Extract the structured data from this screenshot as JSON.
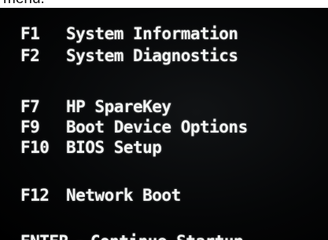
{
  "caption": "menu.",
  "menu": {
    "items": [
      {
        "key": "F1",
        "label": "System Information"
      },
      {
        "key": "F2",
        "label": "System Diagnostics"
      },
      {
        "key": "F7",
        "label": "HP SpareKey"
      },
      {
        "key": "F9",
        "label": "Boot Device Options"
      },
      {
        "key": "F10",
        "label": "BIOS Setup"
      },
      {
        "key": "F12",
        "label": "Network Boot"
      }
    ],
    "enter": {
      "key": "ENTER",
      "separator": "-",
      "label": "Continue Startup"
    }
  },
  "colors": {
    "background": "#000000",
    "text": "#f2f4f3"
  }
}
